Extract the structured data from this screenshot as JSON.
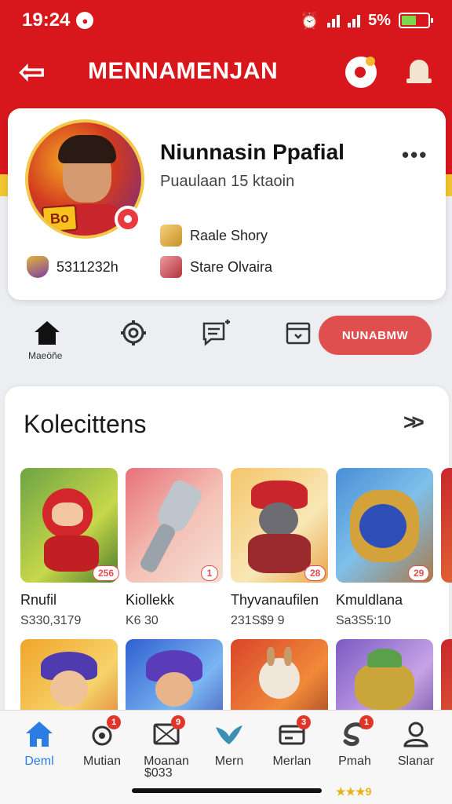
{
  "status_bar": {
    "time": "19:24",
    "battery": "5%"
  },
  "appbar": {
    "title": "MENNAMENJAN"
  },
  "profile": {
    "name": "Niunnasin Ppafial",
    "subtitle": "Puaulaan 15 ktaoin",
    "stat": "5311232h",
    "role": "Raale Shory",
    "class": "Stare Olvaira"
  },
  "quick_actions": {
    "home_label": "Maeöñe",
    "cta": "NUNABMW"
  },
  "collection": {
    "title": "Kolecittens",
    "items": [
      {
        "name": "Rnufil",
        "price": "S330,3179",
        "badge": "256"
      },
      {
        "name": "Kiollekk",
        "price": "K6 30",
        "badge": "1"
      },
      {
        "name": "Thyvanaufilen",
        "price": "231S$9 9",
        "badge": "28"
      },
      {
        "name": "Kmuldlana",
        "price": "Sa3S5:10",
        "badge": "29"
      },
      {
        "name": "",
        "price": "",
        "badge": ""
      },
      {
        "name": "",
        "price": "",
        "badge": ""
      },
      {
        "name": "",
        "price": "",
        "badge": ""
      },
      {
        "name": "",
        "price": "",
        "badge": ""
      }
    ]
  },
  "bottom_nav": {
    "items": [
      {
        "label": "Deml",
        "count": ""
      },
      {
        "label": "Mutian",
        "count": "1"
      },
      {
        "label": "Moanan",
        "count": "9"
      },
      {
        "label": "Mern",
        "count": ""
      },
      {
        "label": "Merlan",
        "count": "3"
      },
      {
        "label": "Pmah",
        "count": "1"
      },
      {
        "label": "Slanar",
        "count": ""
      }
    ],
    "extra": "$033",
    "stars": "★★★9"
  },
  "colors": {
    "brand_red": "#d8171d",
    "accent_yellow": "#f1c531",
    "active_blue": "#2b7de1"
  }
}
